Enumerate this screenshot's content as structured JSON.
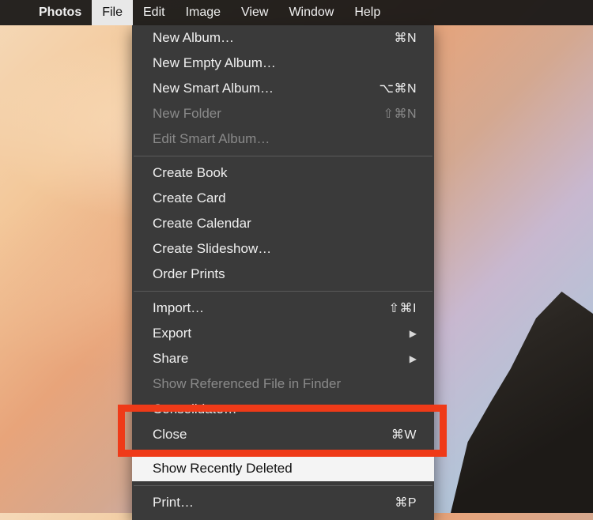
{
  "menu_bar": {
    "app_name": "Photos",
    "items": [
      "File",
      "Edit",
      "Image",
      "View",
      "Window",
      "Help"
    ],
    "active": "File"
  },
  "dropdown": {
    "groups": [
      [
        {
          "label": "New Album…",
          "shortcut": "⌘N",
          "disabled": false
        },
        {
          "label": "New Empty Album…",
          "shortcut": "",
          "disabled": false
        },
        {
          "label": "New Smart Album…",
          "shortcut": "⌥⌘N",
          "disabled": false
        },
        {
          "label": "New Folder",
          "shortcut": "⇧⌘N",
          "disabled": true
        },
        {
          "label": "Edit Smart Album…",
          "shortcut": "",
          "disabled": true
        }
      ],
      [
        {
          "label": "Create Book",
          "shortcut": "",
          "disabled": false
        },
        {
          "label": "Create Card",
          "shortcut": "",
          "disabled": false
        },
        {
          "label": "Create Calendar",
          "shortcut": "",
          "disabled": false
        },
        {
          "label": "Create Slideshow…",
          "shortcut": "",
          "disabled": false
        },
        {
          "label": "Order Prints",
          "shortcut": "",
          "disabled": false
        }
      ],
      [
        {
          "label": "Import…",
          "shortcut": "⇧⌘I",
          "disabled": false
        },
        {
          "label": "Export",
          "shortcut": "",
          "submenu": true,
          "disabled": false
        },
        {
          "label": "Share",
          "shortcut": "",
          "submenu": true,
          "disabled": false
        },
        {
          "label": "Show Referenced File in Finder",
          "shortcut": "",
          "disabled": true
        },
        {
          "label": "Consolidate…",
          "shortcut": "",
          "disabled": false
        },
        {
          "label": "Close",
          "shortcut": "⌘W",
          "disabled": false
        }
      ],
      [
        {
          "label": "Show Recently Deleted",
          "shortcut": "",
          "highlight": true,
          "disabled": false
        }
      ],
      [
        {
          "label": "Print…",
          "shortcut": "⌘P",
          "disabled": false
        }
      ]
    ]
  }
}
